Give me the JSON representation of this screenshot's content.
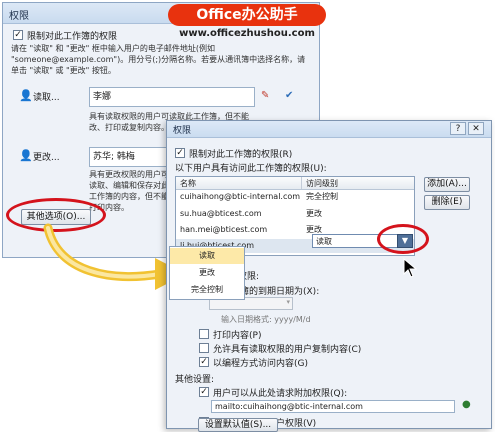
{
  "watermark": {
    "brand": "Office办公助手",
    "url": "www.officezhushou.com"
  },
  "dialog1": {
    "title": "权限",
    "restrict_label": "限制对此工作簿的权限",
    "instructions": "请在 \"读取\" 和 \"更改\" 框中输入用户的电子邮件地址(例如 \"someone@example.com\")。用分号(;)分隔名称。若要从通讯簿中选择名称，请单击 \"读取\" 或 \"更改\" 按钮。",
    "read_button": "读取...",
    "read_value": "李娜",
    "read_desc": "具有读取权限的用户可读取此工作簿，但不能改、打印或复制内容。",
    "change_button": "更改...",
    "change_value": "苏华; 韩梅",
    "change_desc": "具有更改权限的用户可读取、编辑和保存对此工作簿的内容，但不能打印内容。",
    "more_options_button": "其他选项(O)...",
    "help_icon_glyph": "?",
    "close_icon_glyph": "✕"
  },
  "dialog2": {
    "title": "权限",
    "restrict_label": "限制对此工作簿的权限(R)",
    "users_label": "以下用户具有访问此工作簿的权限(U):",
    "columns": [
      "名称",
      "访问级别"
    ],
    "rows": [
      {
        "name": "cuihaihong@btic-internal.com",
        "level": "完全控制"
      },
      {
        "name": "su.hua@bticest.com",
        "level": "更改"
      },
      {
        "name": "han.mei@bticest.com",
        "level": "更改"
      },
      {
        "name": "li.hui@bticest.com",
        "level": "读取"
      }
    ],
    "dropdown_value": "读取",
    "dropdown_options": [
      "读取",
      "更改",
      "完全控制"
    ],
    "add_button": "添加(A)...",
    "delete_button": "删除(E)",
    "additional_label": "用于用户的附加权限:",
    "expire_label": "此工作簿的到期日期为(X):",
    "date_format_hint": "输入日期格式: yyyy/M/d",
    "print_label": "打印内容(P)",
    "copy_label": "允许具有读取权限的用户复制内容(C)",
    "programmatic_label": "以编程方式访问内容(G)",
    "other_settings_label": "其他设置:",
    "request_label": "用户可以从此处请求附加权限(Q):",
    "request_value": "mailto:cuihaihong@btic-internal.com",
    "connection_label": "要求连接验证用户权限(V)",
    "defaults_button": "设置默认值(S)...",
    "help_icon_glyph": "?",
    "close_icon_glyph": "✕"
  },
  "colors": {
    "highlight_red": "#d4131c",
    "watermark_red": "#e8320e",
    "arrow_yellow": "#f1c232"
  }
}
